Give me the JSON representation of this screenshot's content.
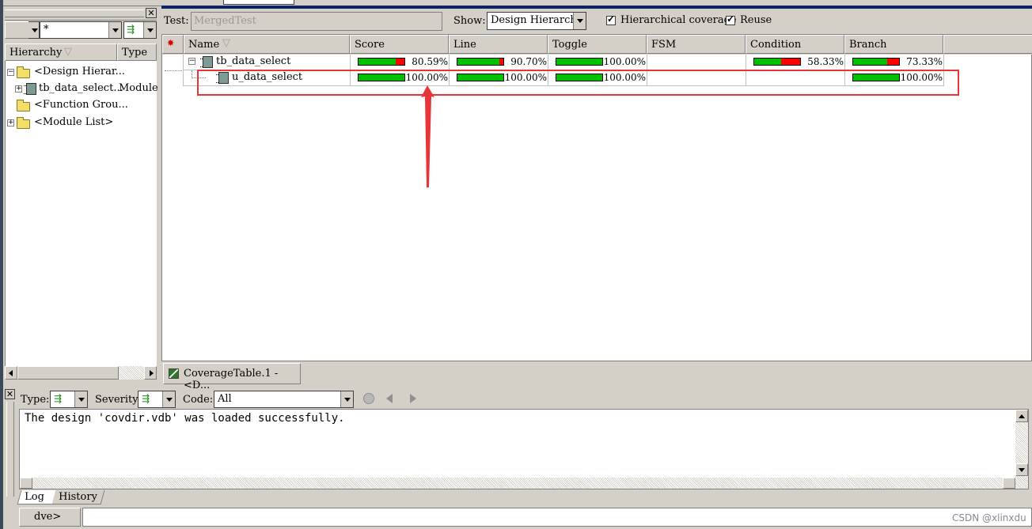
{
  "left_panel": {
    "filter_value": "*",
    "columns": {
      "hierarchy": "Hierarchy",
      "type": "Type"
    },
    "tree": [
      {
        "label": "<Design Hierar...",
        "type": ""
      },
      {
        "label": "tb_data_select...",
        "type": "Module"
      },
      {
        "label": "<Function Grou...",
        "type": ""
      },
      {
        "label": "<Module List>",
        "type": ""
      }
    ]
  },
  "toolbar": {
    "test_label": "Test:",
    "test_value": "MergedTest",
    "show_label": "Show:",
    "show_value": "Design Hierarchy",
    "hier_cov_label": "Hierarchical coverage",
    "reuse_label": "Reuse"
  },
  "table": {
    "columns": [
      "Name",
      "Score",
      "Line",
      "Toggle",
      "FSM",
      "Condition",
      "Branch"
    ],
    "rows": [
      {
        "name": "tb_data_select",
        "score": {
          "text": "80.59%",
          "value": 0.8059
        },
        "line": {
          "text": "90.70%",
          "value": 0.907
        },
        "toggle": {
          "text": "100.00%",
          "value": 1.0
        },
        "fsm": null,
        "condition": {
          "text": "58.33%",
          "value": 0.5833
        },
        "branch": {
          "text": "73.33%",
          "value": 0.7333
        }
      },
      {
        "name": "u_data_select",
        "score": {
          "text": "100.00%",
          "value": 1.0
        },
        "line": {
          "text": "100.00%",
          "value": 1.0
        },
        "toggle": {
          "text": "100.00%",
          "value": 1.0
        },
        "fsm": null,
        "condition": null,
        "branch": {
          "text": "100.00%",
          "value": 1.0
        }
      }
    ]
  },
  "doc_tab": {
    "label": "CoverageTable.1 - <D..."
  },
  "log_panel": {
    "type_label": "Type:",
    "severity_label": "Severity:",
    "code_label": "Code:",
    "code_value": "All",
    "message": "The design 'covdir.vdb' was loaded successfully.",
    "tabs": [
      "Log",
      "History"
    ]
  },
  "console": {
    "prompt": "dve>"
  },
  "watermark": "CSDN @xlinxdu",
  "colors": {
    "covered": "#00c000",
    "uncovered": "#ff0000",
    "highlight": "#e8353a",
    "titlebar": "#0a246a"
  }
}
